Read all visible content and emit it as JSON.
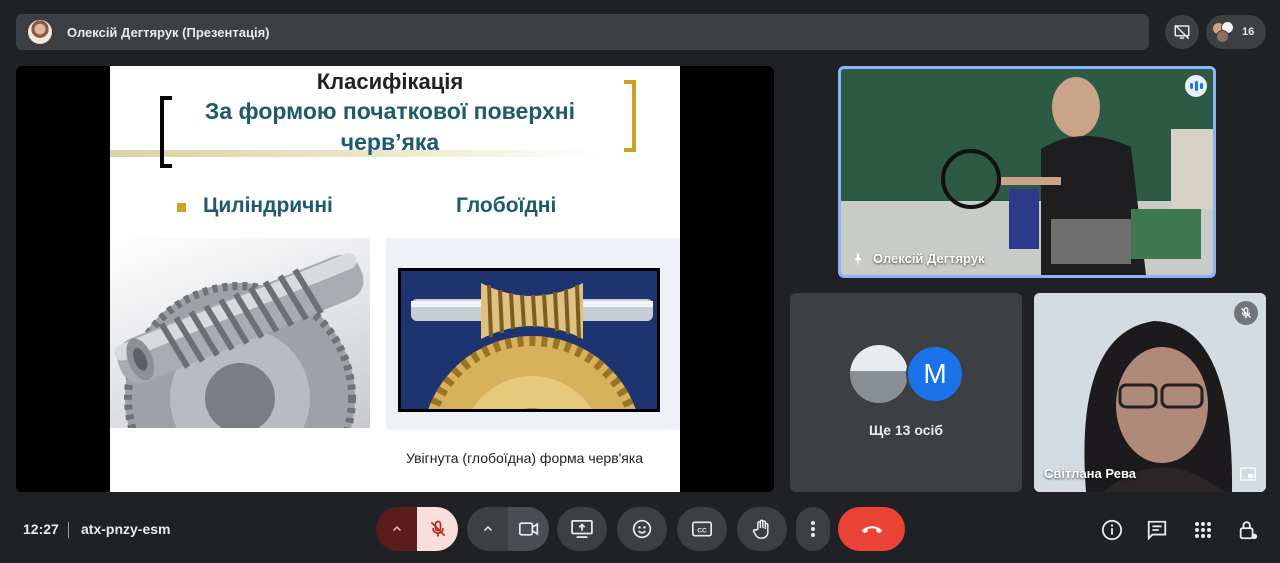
{
  "header": {
    "presenter_title": "Олексій Дегтярук (Презентація)",
    "participant_count": "16"
  },
  "slide": {
    "heading": "Класифікація",
    "subtitle_line1": "За формою початкової поверхні",
    "subtitle_line2": "черв’яка",
    "col_left": "Циліндричні",
    "col_right": "Глобоїдні",
    "caption": "Увігнута (глобоїдна) форма черв'яка"
  },
  "tiles": {
    "main_speaker": "Олексій Дегтярук",
    "others_avatar_letter": "M",
    "others_label": "Ще 13 осіб",
    "participant2": "Світлана Рева"
  },
  "footer": {
    "time": "12:27",
    "meeting_code": "atx-pnzy-esm"
  },
  "colors": {
    "accent_blue": "#8ab4f8",
    "end_call_red": "#ea4335",
    "mic_off_bg": "#f9dedc",
    "mic_off_icon": "#b3261e",
    "slide_title_teal": "#1e5a6e",
    "slide_gold": "#c9a227"
  },
  "icons": [
    "presentation-off-icon",
    "people-icon",
    "pin-icon",
    "speaking-icon",
    "mic-off-icon",
    "chevron-up-icon",
    "camera-icon",
    "present-screen-icon",
    "emoji-icon",
    "captions-icon",
    "raise-hand-icon",
    "more-vert-icon",
    "call-end-icon",
    "info-icon",
    "chat-icon",
    "activities-icon",
    "host-controls-icon",
    "pip-icon"
  ]
}
